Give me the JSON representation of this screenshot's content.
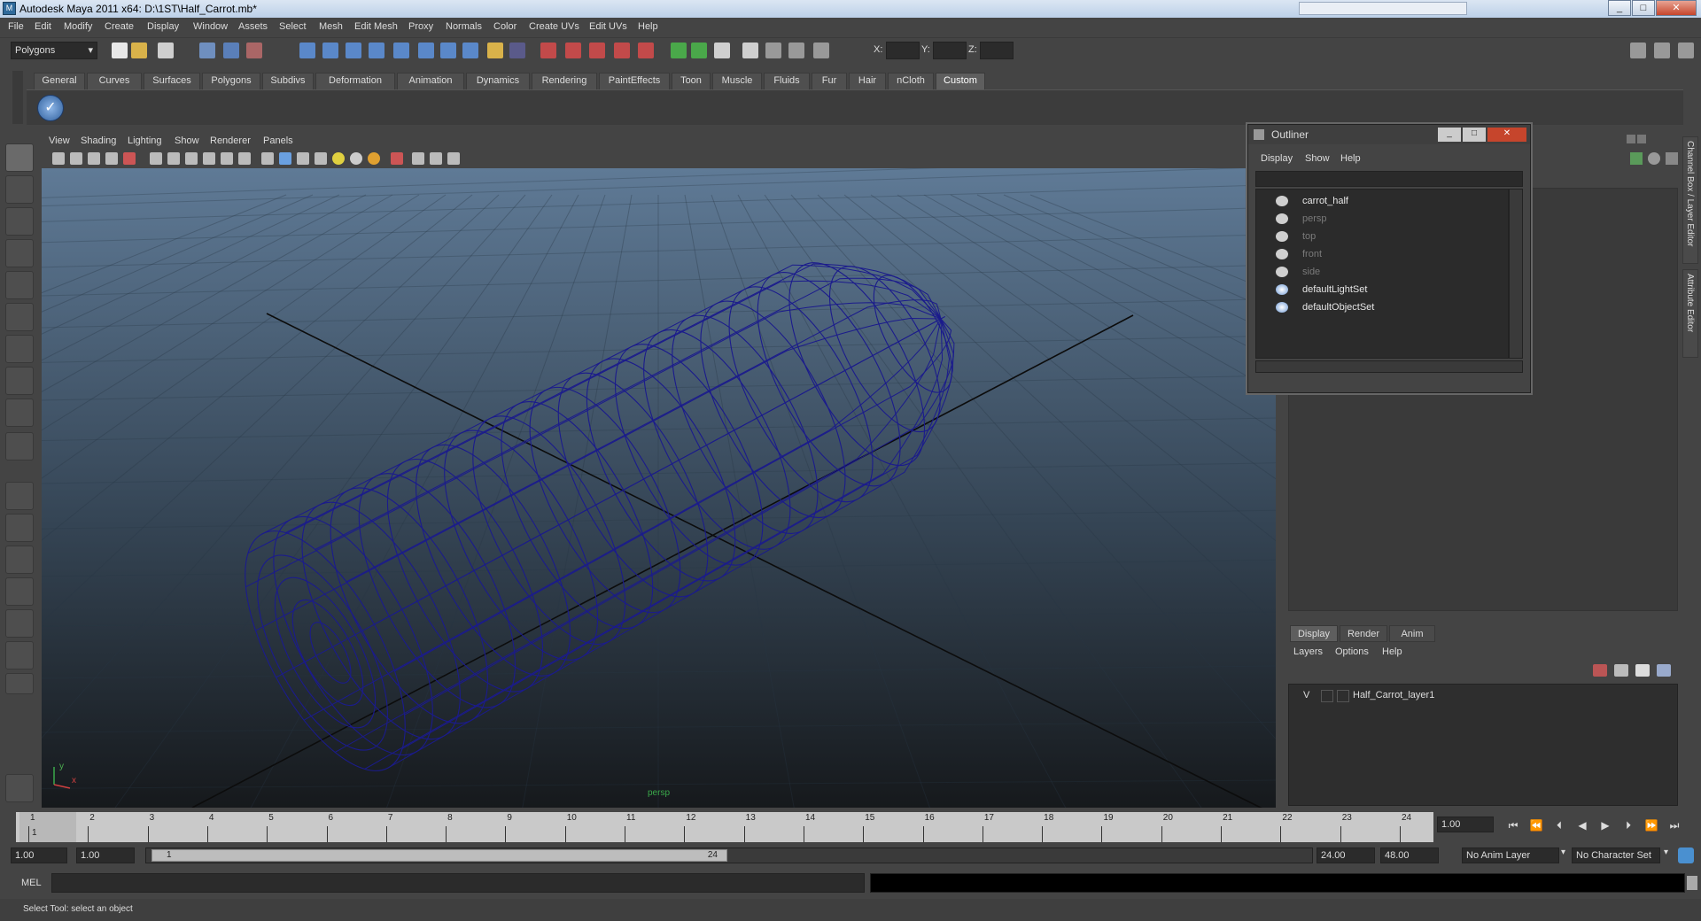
{
  "window": {
    "title": "Autodesk Maya 2011 x64: D:\\1ST\\Half_Carrot.mb*",
    "app_icon": "maya-icon",
    "minimize": "_",
    "maximize": "□",
    "close": "✕"
  },
  "menus": [
    "File",
    "Edit",
    "Modify",
    "Create",
    "Display",
    "Window",
    "Assets",
    "Select",
    "Mesh",
    "Edit Mesh",
    "Proxy",
    "Normals",
    "Color",
    "Create UVs",
    "Edit UVs",
    "Help"
  ],
  "statusline": {
    "mode": "Polygons",
    "x_label": "X:",
    "y_label": "Y:",
    "z_label": "Z:"
  },
  "shelf": {
    "tabs": [
      "General",
      "Curves",
      "Surfaces",
      "Polygons",
      "Subdivs",
      "Deformation",
      "Animation",
      "Dynamics",
      "Rendering",
      "PaintEffects",
      "Toon",
      "Muscle",
      "Fluids",
      "Fur",
      "Hair",
      "nCloth",
      "Custom"
    ],
    "active_tab": "Custom"
  },
  "viewport": {
    "menus": [
      "View",
      "Shading",
      "Lighting",
      "Show",
      "Renderer",
      "Panels"
    ],
    "camera_label": "persp",
    "axis_y": "y",
    "axis_x": "x",
    "wire_color": "#1b1b8c"
  },
  "outliner": {
    "title": "Outliner",
    "menus": [
      "Display",
      "Show",
      "Help"
    ],
    "items": [
      {
        "label": "carrot_half",
        "dim": false,
        "icon": "mesh-icon"
      },
      {
        "label": "persp",
        "dim": true,
        "icon": "camera-icon"
      },
      {
        "label": "top",
        "dim": true,
        "icon": "camera-icon"
      },
      {
        "label": "front",
        "dim": true,
        "icon": "camera-icon"
      },
      {
        "label": "side",
        "dim": true,
        "icon": "camera-icon"
      },
      {
        "label": "defaultLightSet",
        "dim": false,
        "icon": "set-icon"
      },
      {
        "label": "defaultObjectSet",
        "dim": false,
        "icon": "set-icon"
      }
    ]
  },
  "layer_editor": {
    "tabs": [
      "Display",
      "Render",
      "Anim"
    ],
    "active_tab": "Display",
    "menus": [
      "Layers",
      "Options",
      "Help"
    ],
    "layers": [
      {
        "visible": "V",
        "name": "Half_Carrot_layer1"
      }
    ]
  },
  "side_tabs": [
    "Channel Box / Layer Editor",
    "Attribute Editor"
  ],
  "timeline": {
    "ticks": [
      "1",
      "2",
      "3",
      "4",
      "5",
      "6",
      "7",
      "8",
      "9",
      "10",
      "11",
      "12",
      "13",
      "14",
      "15",
      "16",
      "17",
      "18",
      "19",
      "20",
      "21",
      "22",
      "23",
      "24"
    ],
    "current_frame_marker": "1",
    "current_time": "1.00"
  },
  "range": {
    "start_time": "1.00",
    "playback_start": "1.00",
    "range_start_label": "1",
    "range_end_label": "24",
    "playback_end": "24.00",
    "end_time": "48.00",
    "anim_layer": "No Anim Layer",
    "character_set": "No Character Set"
  },
  "command": {
    "language": "MEL"
  },
  "help_line": "Select Tool: select an object"
}
